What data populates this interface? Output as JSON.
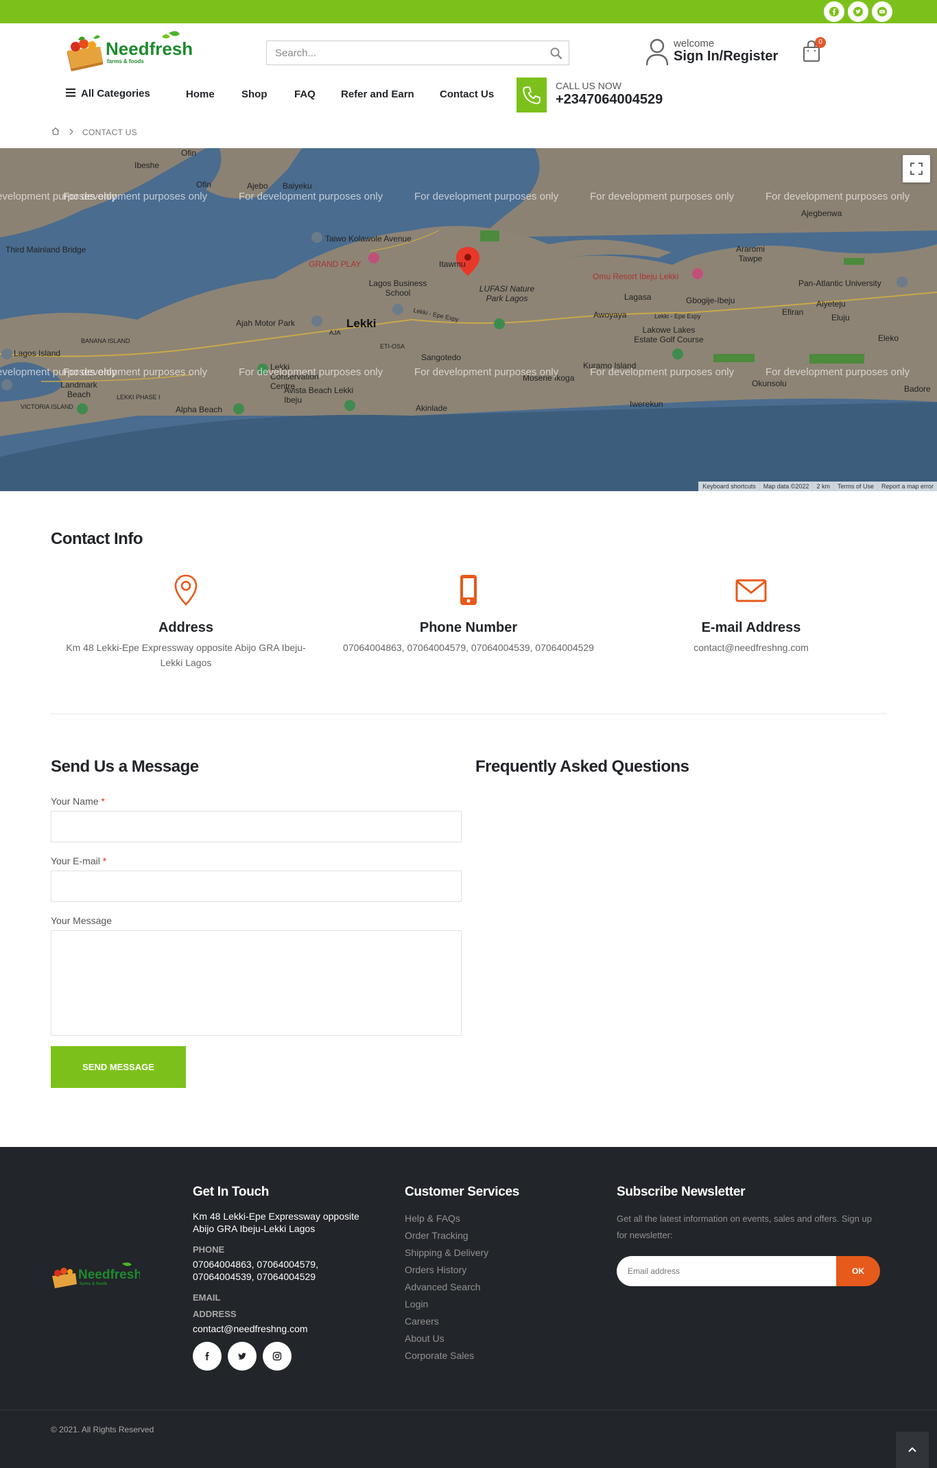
{
  "colors": {
    "brand_green": "#7cc11b",
    "accent_orange": "#e65a1b",
    "footer_bg": "#222529",
    "map_water": "#45678c"
  },
  "topbar": {
    "socials": [
      "facebook-icon",
      "twitter-icon",
      "youtube-icon"
    ]
  },
  "header": {
    "logo_text": "Needfresh",
    "logo_tagline": "farms & foods",
    "search_placeholder": "Search...",
    "welcome": "welcome",
    "signin": "Sign In/Register",
    "cart_count": "0"
  },
  "nav": {
    "all_categories": "All Categories",
    "items": [
      "Home",
      "Shop",
      "FAQ",
      "Refer and Earn",
      "Contact Us"
    ],
    "call_label": "CALL US NOW",
    "call_number": "+2347064004529"
  },
  "breadcrumb": {
    "current": "CONTACT US"
  },
  "map": {
    "watermark": "For development purposes only",
    "labels": [
      "Ofin",
      "Ibeshe",
      "Ajebo",
      "Baiyeku",
      "Ajegbenwa",
      "Araromi Tawpe",
      "Third Mainland Bridge",
      "Taiwo Kolawole Avenue",
      "Itawmu",
      "GRAND PLAY",
      "Lagos Business School",
      "LUFASI Nature Park Lagos",
      "Omu Resort Ibeju Lekki",
      "Pan-Atlantic University",
      "Lagasa",
      "Gbogije-Ibeju",
      "Aiyeteju",
      "Efiran",
      "Eluju",
      "Ajah Motor Park",
      "Lekki",
      "Awoyaya",
      "Lakowe Lakes Estate Golf Course",
      "Eleko",
      "Lagos Island",
      "BANANA ISLAND",
      "AJA",
      "ETI-OSA",
      "Sangotedo",
      "Kuramo Island",
      "Moserie Ikoga",
      "Okunsolu",
      "Badore",
      "Landmark Beach",
      "VICTORIA ISLAND",
      "LEKKI PHASE I",
      "Lekki Conservation Centre",
      "Avista Beach Lekki Ibeju",
      "Alpha Beach",
      "Akinlade",
      "Iwerekun",
      "Lekki - Epe Expy"
    ],
    "footer": [
      "Keyboard shortcuts",
      "Map data ©2022",
      "2 km",
      "Terms of Use",
      "Report a map error"
    ]
  },
  "contact_info": {
    "heading": "Contact Info",
    "items": [
      {
        "title": "Address",
        "text": "Km 48 Lekki-Epe Expressway opposite Abijo GRA Ibeju-Lekki Lagos",
        "icon": "location-pin-icon"
      },
      {
        "title": "Phone Number",
        "text": "07064004863, 07064004579, 07064004539, 07064004529",
        "icon": "mobile-phone-icon"
      },
      {
        "title": "E-mail Address",
        "text": "contact@needfreshng.com",
        "icon": "envelope-icon"
      }
    ]
  },
  "form": {
    "heading": "Send Us a Message",
    "name_label": "Your Name",
    "email_label": "Your E-mail",
    "message_label": "Your Message",
    "required_mark": "*",
    "submit": "SEND MESSAGE"
  },
  "faq": {
    "heading": "Frequently Asked Questions"
  },
  "footer": {
    "get_in_touch": {
      "heading": "Get In Touch",
      "address": "Km 48 Lekki-Epe Expressway opposite Abijo GRA Ibeju-Lekki Lagos",
      "phone_label": "PHONE",
      "phone": "07064004863, 07064004579, 07064004539, 07064004529",
      "email_label": "EMAIL",
      "address_label": "ADDRESS",
      "email": "contact@needfreshng.com"
    },
    "customer_services": {
      "heading": "Customer Services",
      "links": [
        "Help & FAQs",
        "Order Tracking",
        "Shipping & Delivery",
        "Orders History",
        "Advanced Search",
        "Login",
        "Careers",
        "About Us",
        "Corporate Sales"
      ]
    },
    "newsletter": {
      "heading": "Subscribe Newsletter",
      "description": "Get all the latest information on events, sales and offers. Sign up for newsletter:",
      "placeholder": "Email address",
      "button": "OK"
    },
    "copyright": "© 2021. All Rights Reserved"
  }
}
